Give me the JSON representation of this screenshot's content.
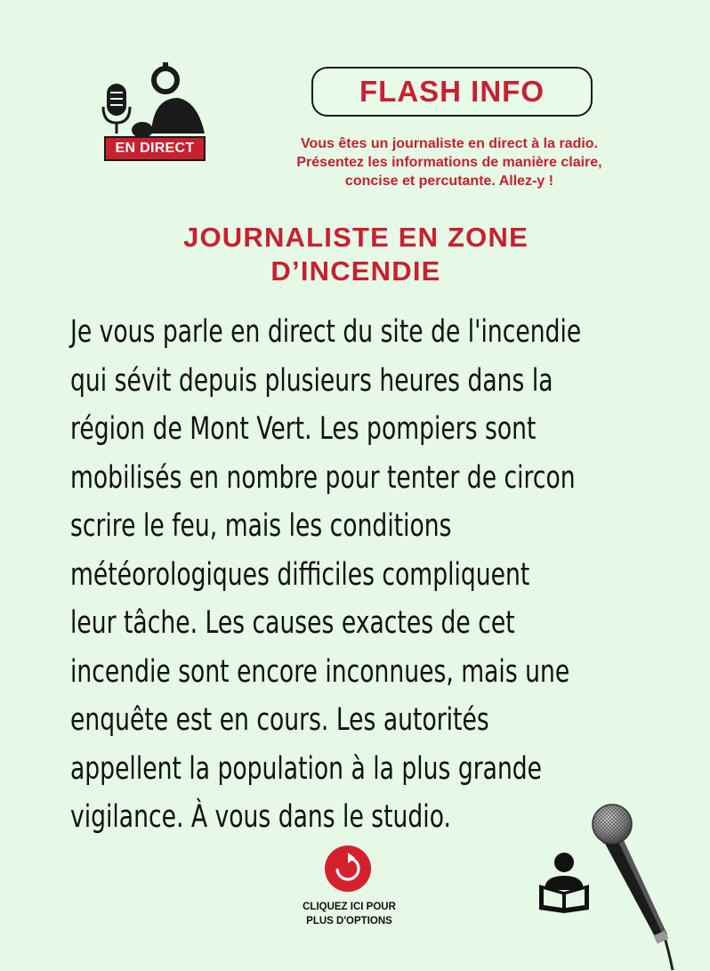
{
  "header": {
    "live_badge": "EN DIRECT",
    "flash_title": "FLASH INFO",
    "instructions": [
      "Vous êtes un journaliste en direct à la radio.",
      "Présentez les informations de manière claire,",
      "concise et percutante. Allez-y !"
    ]
  },
  "card": {
    "title_lines": [
      "JOURNALISTE EN ZONE",
      "D’INCENDIE"
    ],
    "body_lines": [
      "Je vous parle en direct du site de l'incendie",
      "qui sévit depuis plusieurs heures dans la",
      "région de Mont Vert. Les pompiers sont",
      "mobilisés en nombre pour tenter de circon",
      "scrire le feu, mais les conditions",
      "météorologiques difficiles compliquent",
      "leur tâche. Les causes exactes de cet",
      "incendie sont encore inconnues, mais une",
      "enquête est en cours. Les autorités",
      "appellent la population à la plus grande",
      "vigilance. À vous dans le studio."
    ]
  },
  "footer": {
    "options_label_lines": [
      "CLIQUEZ ICI POUR",
      "PLUS D'OPTIONS"
    ]
  },
  "icons": {
    "studio": "radio-host-icon",
    "options": "refresh-icon",
    "reader": "reader-icon",
    "microphone": "microphone-icon"
  },
  "colors": {
    "background": "#e6f9e6",
    "accent": "#c9202f",
    "text": "#111111"
  }
}
